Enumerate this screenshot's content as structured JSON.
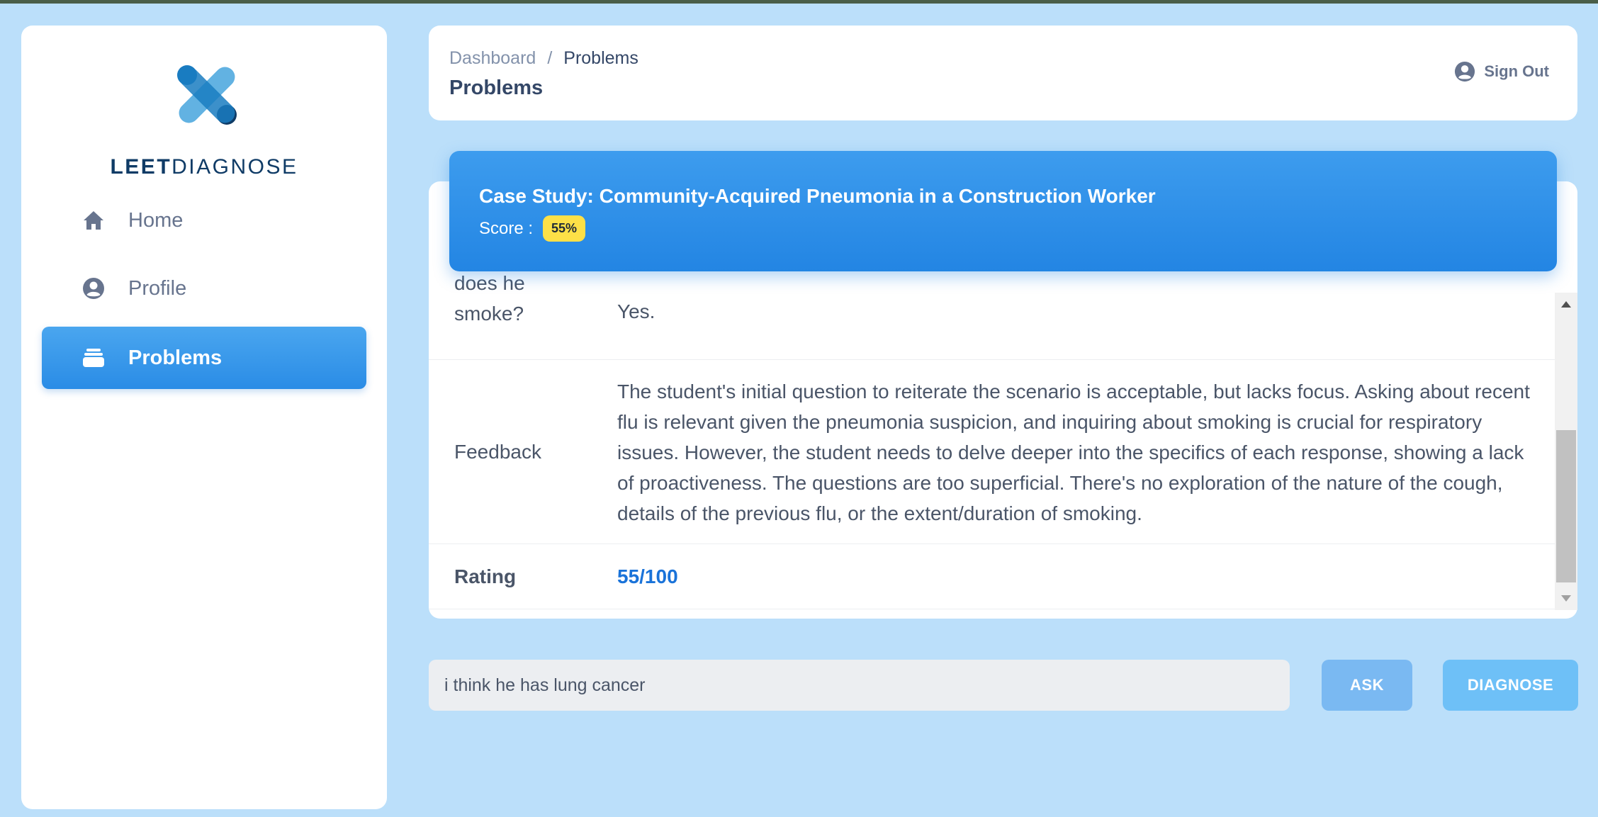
{
  "brand": {
    "name_bold": "LEET",
    "name_regular": "DIAGNOSE"
  },
  "sidebar": {
    "items": [
      {
        "label": "Home",
        "icon": "home-icon",
        "active": false
      },
      {
        "label": "Profile",
        "icon": "user-circle-icon",
        "active": false
      },
      {
        "label": "Problems",
        "icon": "stack-icon",
        "active": true
      }
    ]
  },
  "header": {
    "breadcrumb": {
      "root": "Dashboard",
      "separator": "/",
      "current": "Problems"
    },
    "title": "Problems",
    "signout_label": "Sign Out"
  },
  "case": {
    "title": "Case Study: Community-Acquired Pneumonia in a Construction Worker",
    "score_label": "Score :",
    "score_value": "55%"
  },
  "table": {
    "question_row": {
      "label": "does he smoke?",
      "value": "Yes."
    },
    "feedback_row": {
      "label": "Feedback",
      "value": "The student's initial question to reiterate the scenario is acceptable, but lacks focus. Asking about recent flu is relevant given the pneumonia suspicion, and inquiring about smoking is crucial for respiratory issues. However, the student needs to delve deeper into the specifics of each response, showing a lack of proactiveness. The questions are too superficial. There's no exploration of the nature of the cough, details of the previous flu, or the extent/duration of smoking."
    },
    "rating_row": {
      "label": "Rating",
      "value": "55/100"
    }
  },
  "input": {
    "value": "i think he has lung cancer"
  },
  "buttons": {
    "ask_label": "ASK",
    "diagnose_label": "DIAGNOSE"
  },
  "colors": {
    "background": "#bbdffa",
    "accent": "#2a8ce6",
    "score_badge": "#fde047",
    "rating_text": "#1a73d9"
  }
}
